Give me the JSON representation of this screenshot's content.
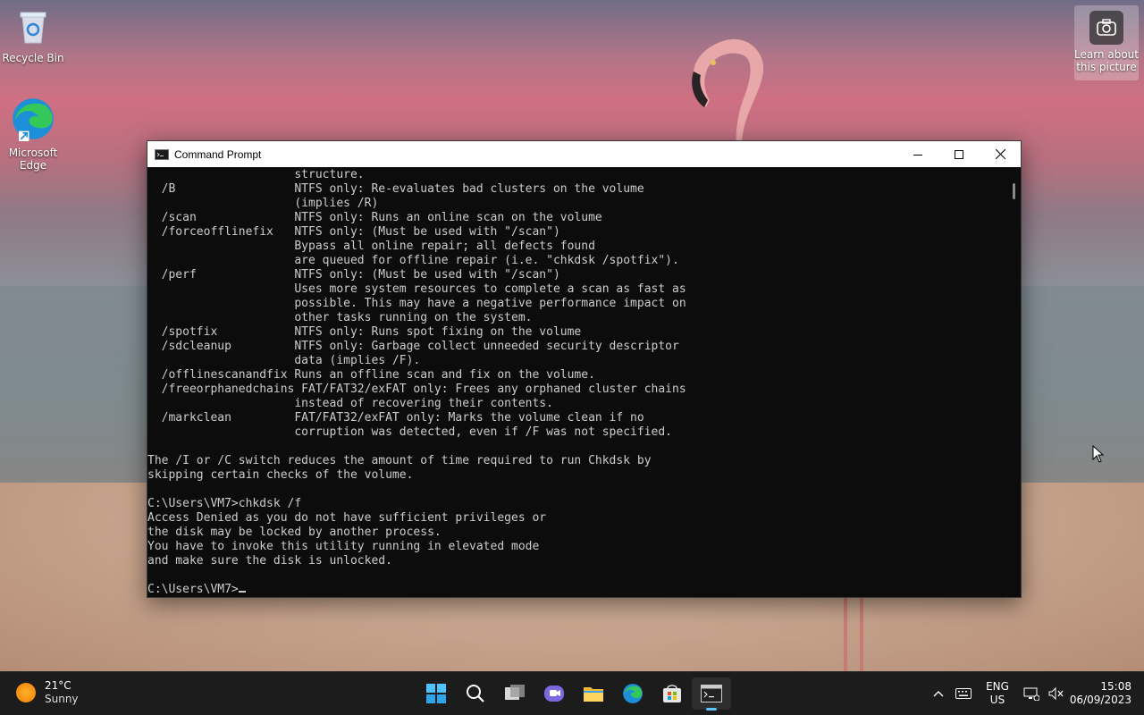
{
  "desktop": {
    "icons": [
      {
        "label": "Recycle Bin",
        "icon": "recycle-bin-icon"
      },
      {
        "label": "Microsoft Edge",
        "icon": "edge-icon"
      }
    ],
    "learn_label": "Learn about this picture"
  },
  "window": {
    "title": "Command Prompt",
    "lines": [
      "                     structure.",
      "  /B                 NTFS only: Re-evaluates bad clusters on the volume",
      "                     (implies /R)",
      "  /scan              NTFS only: Runs an online scan on the volume",
      "  /forceofflinefix   NTFS only: (Must be used with \"/scan\")",
      "                     Bypass all online repair; all defects found",
      "                     are queued for offline repair (i.e. \"chkdsk /spotfix\").",
      "  /perf              NTFS only: (Must be used with \"/scan\")",
      "                     Uses more system resources to complete a scan as fast as",
      "                     possible. This may have a negative performance impact on",
      "                     other tasks running on the system.",
      "  /spotfix           NTFS only: Runs spot fixing on the volume",
      "  /sdcleanup         NTFS only: Garbage collect unneeded security descriptor",
      "                     data (implies /F).",
      "  /offlinescanandfix Runs an offline scan and fix on the volume.",
      "  /freeorphanedchains FAT/FAT32/exFAT only: Frees any orphaned cluster chains",
      "                     instead of recovering their contents.",
      "  /markclean         FAT/FAT32/exFAT only: Marks the volume clean if no",
      "                     corruption was detected, even if /F was not specified.",
      "",
      "The /I or /C switch reduces the amount of time required to run Chkdsk by",
      "skipping certain checks of the volume.",
      "",
      "C:\\Users\\VM7>chkdsk /f",
      "Access Denied as you do not have sufficient privileges or",
      "the disk may be locked by another process.",
      "You have to invoke this utility running in elevated mode",
      "and make sure the disk is unlocked.",
      ""
    ],
    "prompt": "C:\\Users\\VM7>"
  },
  "taskbar": {
    "weather_temp": "21°C",
    "weather_cond": "Sunny",
    "lang_top": "ENG",
    "lang_bottom": "US",
    "time": "15:08",
    "date": "06/09/2023",
    "accent": "#5cc4ff"
  }
}
